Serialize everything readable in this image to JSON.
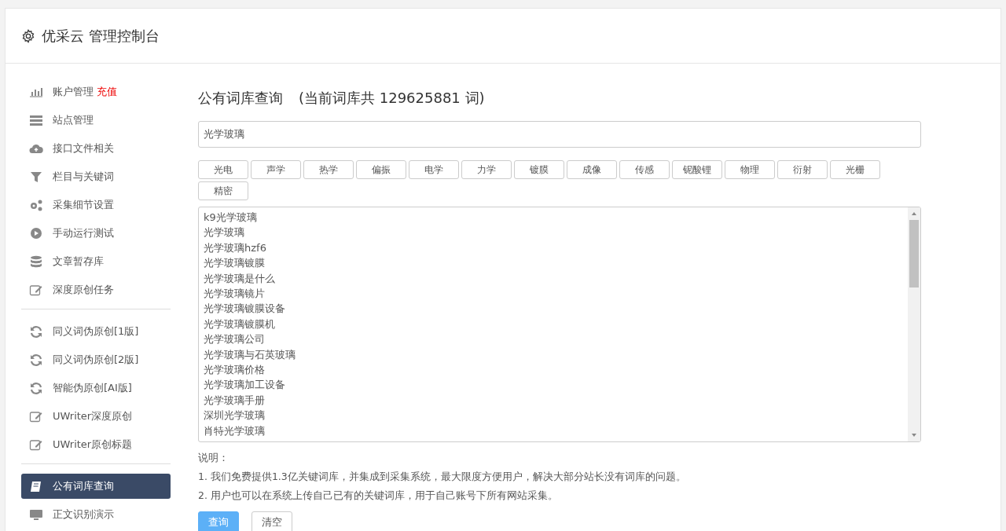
{
  "header": {
    "title": "优采云 管理控制台"
  },
  "sidebar": {
    "groups": [
      {
        "items": [
          {
            "label": "账户管理",
            "badge": "充值",
            "selected": false
          },
          {
            "label": "站点管理",
            "selected": false
          },
          {
            "label": "接口文件相关",
            "selected": false
          },
          {
            "label": "栏目与关键词",
            "selected": false
          },
          {
            "label": "采集细节设置",
            "selected": false
          },
          {
            "label": "手动运行测试",
            "selected": false
          },
          {
            "label": "文章暂存库",
            "selected": false
          },
          {
            "label": "深度原创任务",
            "selected": false
          }
        ]
      },
      {
        "items": [
          {
            "label": "同义词伪原创[1版]",
            "selected": false
          },
          {
            "label": "同义词伪原创[2版]",
            "selected": false
          },
          {
            "label": "智能伪原创[AI版]",
            "selected": false
          },
          {
            "label": "UWriter深度原创",
            "selected": false
          },
          {
            "label": "UWriter原创标题",
            "selected": false
          }
        ]
      },
      {
        "items": [
          {
            "label": "公有词库查询",
            "selected": true
          },
          {
            "label": "正文识别演示",
            "selected": false
          }
        ]
      }
    ]
  },
  "main": {
    "title": "公有词库查询",
    "count_text": "(当前词库共 129625881 词)",
    "search": {
      "value": "光学玻璃"
    },
    "tags": [
      "光电",
      "声学",
      "热学",
      "偏振",
      "电学",
      "力学",
      "镀膜",
      "成像",
      "传感",
      "铌酸锂",
      "物理",
      "衍射",
      "光栅",
      "精密"
    ],
    "results": [
      "k9光学玻璃",
      "光学玻璃",
      "光学玻璃hzf6",
      "光学玻璃镀膜",
      "光学玻璃是什么",
      "光学玻璃镜片",
      "光学玻璃镀膜设备",
      "光学玻璃镀膜机",
      "光学玻璃公司",
      "光学玻璃与石英玻璃",
      "光学玻璃价格",
      "光学玻璃加工设备",
      "光学玻璃手册",
      "深圳光学玻璃",
      "肖特光学玻璃"
    ],
    "notes_label": "说明：",
    "notes": [
      "1. 我们免费提供1.3亿关键词库，并集成到采集系统，最大限度方便用户，解决大部分站长没有词库的问题。",
      "2. 用户也可以在系统上传自己已有的关键词库，用于自己账号下所有网站采集。"
    ],
    "buttons": [
      {
        "label": "查询",
        "kind": "primary"
      },
      {
        "label": "清空",
        "kind": "default"
      }
    ]
  }
}
